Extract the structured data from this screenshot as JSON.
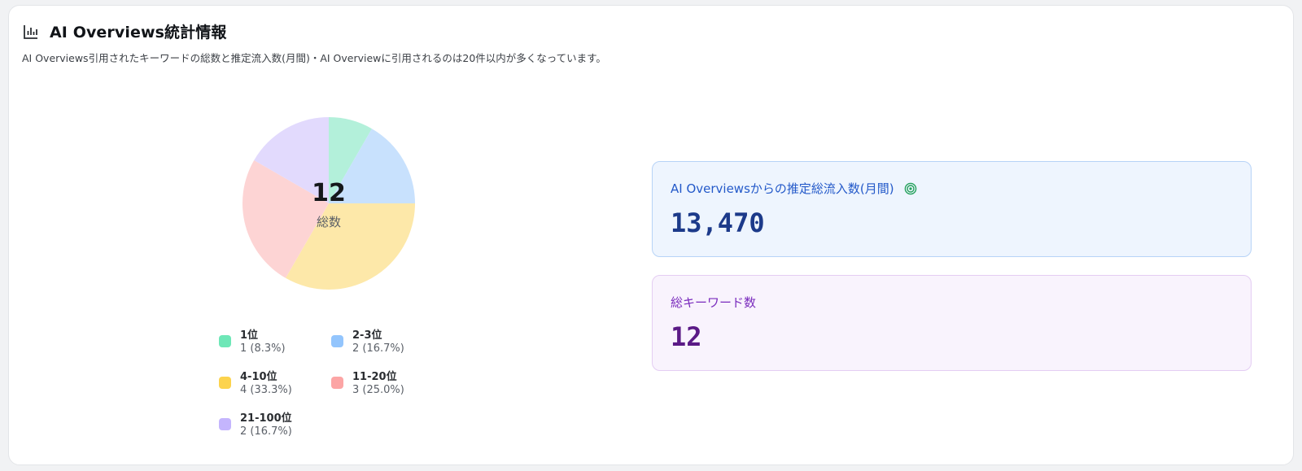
{
  "header": {
    "title": "AI Overviews統計情報",
    "subtitle": "AI Overviews引用されたキーワードの総数と推定流入数(月間)・AI Overviewに引用されるのは20件以内が多くなっています。",
    "icon": "bar-chart-icon"
  },
  "chart_data": {
    "type": "pie",
    "center_value": "12",
    "center_label": "総数",
    "slices": [
      {
        "name": "1位",
        "value": 1,
        "value_text": "1 (8.3%)",
        "color": "#b3f0da",
        "legend_color": "#6ee7b7"
      },
      {
        "name": "2-3位",
        "value": 2,
        "value_text": "2 (16.7%)",
        "color": "#c8e1fd",
        "legend_color": "#93c5fd"
      },
      {
        "name": "4-10位",
        "value": 4,
        "value_text": "4 (33.3%)",
        "color": "#fde8a9",
        "legend_color": "#fcd34d"
      },
      {
        "name": "11-20位",
        "value": 3,
        "value_text": "3 (25.0%)",
        "color": "#fdd4d4",
        "legend_color": "#fca5a5"
      },
      {
        "name": "21-100位",
        "value": 2,
        "value_text": "2 (16.7%)",
        "color": "#e2dafd",
        "legend_color": "#c4b5fd"
      }
    ]
  },
  "stats": {
    "traffic": {
      "label": "AI Overviewsからの推定総流入数(月間)",
      "value": "13,470",
      "icon": "target-icon"
    },
    "keywords": {
      "label": "総キーワード数",
      "value": "12"
    }
  }
}
